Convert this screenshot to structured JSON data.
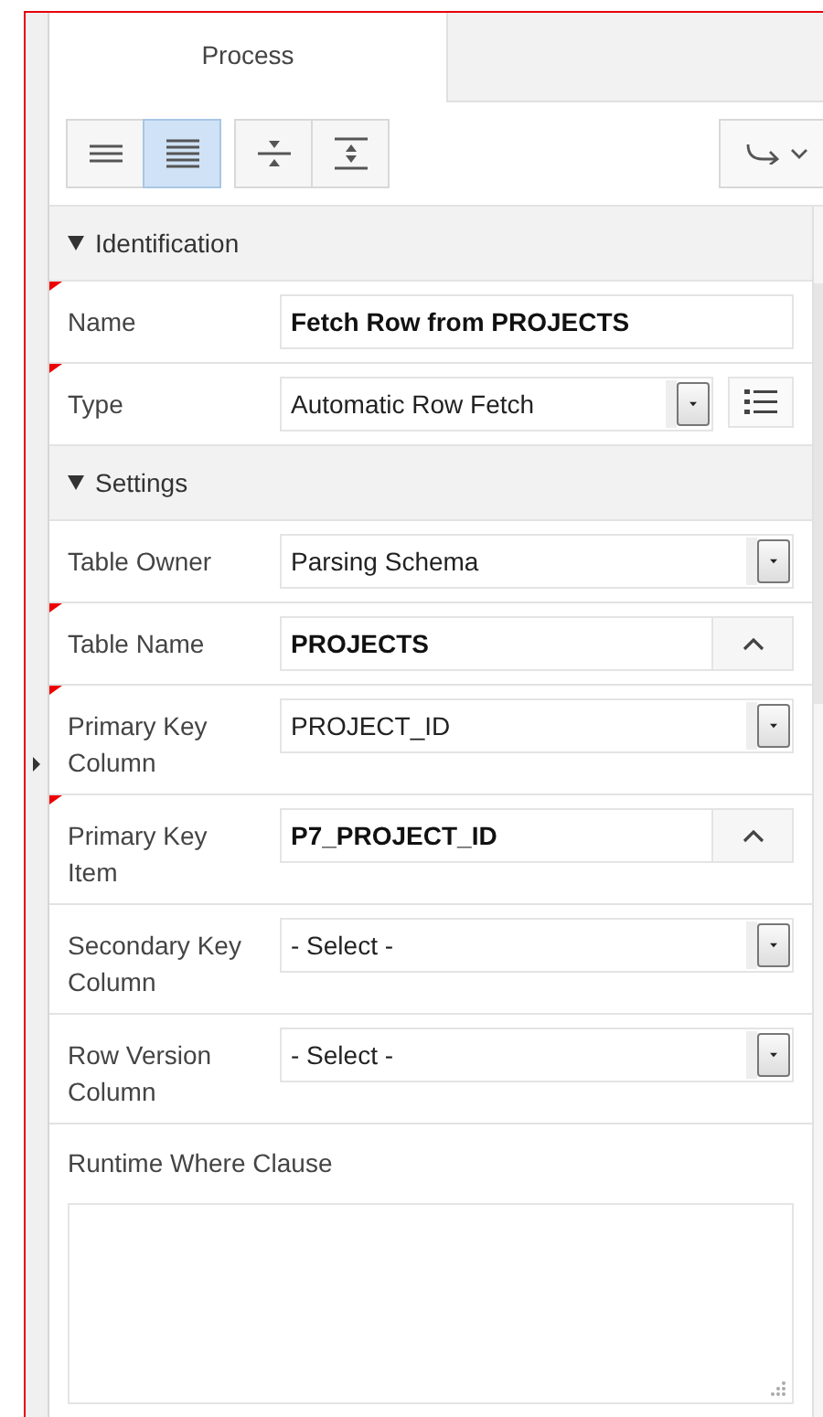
{
  "tabs": [
    {
      "label": "Process",
      "selected": true
    }
  ],
  "toolbar": {
    "view_buttons": [
      {
        "kind": "lines",
        "selected": false
      },
      {
        "kind": "dense",
        "selected": true
      },
      {
        "kind": "collapse",
        "selected": false
      },
      {
        "kind": "expand",
        "selected": false
      }
    ]
  },
  "sections": [
    {
      "title": "Identification",
      "expanded": true,
      "rows": [
        {
          "label": "Name",
          "kind": "text",
          "value": "Fetch Row from PROJECTS",
          "required": true
        },
        {
          "label": "Type",
          "kind": "select_list",
          "value": "Automatic Row Fetch",
          "required": true
        }
      ]
    },
    {
      "title": "Settings",
      "expanded": true,
      "rows": [
        {
          "label": "Table Owner",
          "kind": "select",
          "value": "Parsing Schema",
          "required": false
        },
        {
          "label": "Table Name",
          "kind": "popup",
          "value": "PROJECTS",
          "required": true
        },
        {
          "label": "Primary Key Column",
          "kind": "select",
          "value": "PROJECT_ID",
          "required": true
        },
        {
          "label": "Primary Key Item",
          "kind": "popup",
          "value": "P7_PROJECT_ID",
          "required": true
        },
        {
          "label": "Secondary Key Column",
          "kind": "select",
          "value": "- Select -",
          "required": false
        },
        {
          "label": "Row Version Column",
          "kind": "select",
          "value": "- Select -",
          "required": false
        },
        {
          "label": "Runtime Where Clause",
          "kind": "textarea",
          "value": "",
          "required": false
        }
      ]
    }
  ]
}
